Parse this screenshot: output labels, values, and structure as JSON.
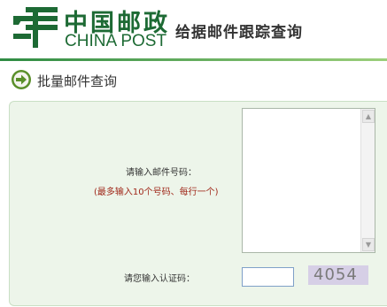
{
  "header": {
    "brand_cn": "中国邮政",
    "brand_en": "CHINA POST",
    "title": "给据邮件跟踪查询"
  },
  "section": {
    "icon": "arrow-right-circle-icon",
    "title": "批量邮件查询"
  },
  "form": {
    "number_label": "请输入邮件号码：",
    "number_hint": "(最多输入10个号码、每行一个)",
    "numbers_value": "",
    "captcha_label": "请您输入认证码：",
    "captcha_value": "",
    "captcha_code": "4054"
  },
  "colors": {
    "brand_green": "#1d6a34",
    "panel_bg": "#edf5ea",
    "hint_red": "#a0281a"
  }
}
